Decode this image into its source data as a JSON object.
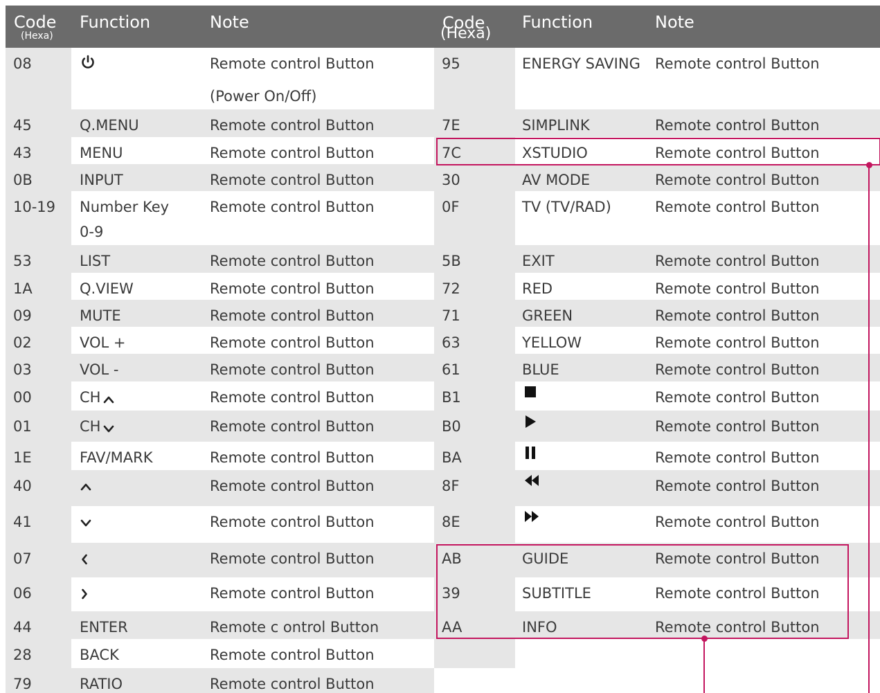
{
  "headers": {
    "left": {
      "code": "Code",
      "code_sub": "(Hexa)",
      "function": "Function",
      "note": "Note"
    },
    "right": {
      "code": "Code",
      "code_sub": "(Hexa)",
      "function": "Function",
      "note": "Note"
    }
  },
  "left_rows": [
    {
      "code": "08",
      "function": "",
      "icon": "power-icon",
      "note": "Remote control Button",
      "note2": "(Power On/Off)"
    },
    {
      "code": "45",
      "function": "Q.MENU",
      "note": "Remote control Button"
    },
    {
      "code": "43",
      "function": "MENU",
      "note": "Remote control Button"
    },
    {
      "code": "0B",
      "function": "INPUT",
      "note": "Remote control Button"
    },
    {
      "code": "10-19",
      "function": "Number Key",
      "function2": "0-9",
      "note": "Remote control Button"
    },
    {
      "code": "53",
      "function": "LIST",
      "note": "Remote control Button"
    },
    {
      "code": "1A",
      "function": "Q.VIEW",
      "note": "Remote control Button"
    },
    {
      "code": "09",
      "function": "MUTE",
      "note": "Remote control Button"
    },
    {
      "code": "02",
      "function": "VOL +",
      "note": "Remote control Button"
    },
    {
      "code": "03",
      "function": "VOL -",
      "note": "Remote control Button"
    },
    {
      "code": "00",
      "function": "CH",
      "icon": "chevron-up-icon",
      "note": "Remote control Button"
    },
    {
      "code": "01",
      "function": "CH",
      "icon": "chevron-down-icon",
      "note": "Remote control Button"
    },
    {
      "code": "1E",
      "function": "FAV/MARK",
      "note": "Remote control Button"
    },
    {
      "code": "40",
      "function": "",
      "icon": "chevron-up-icon",
      "note": "Remote control Button"
    },
    {
      "code": "41",
      "function": "",
      "icon": "chevron-down-icon",
      "note": "Remote control Button"
    },
    {
      "code": "07",
      "function": "",
      "icon": "chevron-left-icon",
      "note": "Remote control Button"
    },
    {
      "code": "06",
      "function": "",
      "icon": "chevron-right-icon",
      "note": "Remote control Button"
    },
    {
      "code": "44",
      "function": "ENTER",
      "note": "Remote c ontrol Button"
    },
    {
      "code": "28",
      "function": "BACK",
      "note": "Remote control Button"
    },
    {
      "code": "79",
      "function": "RATIO",
      "note": "Remote control Button"
    }
  ],
  "right_rows": [
    {
      "code": "95",
      "function": "ENERGY SAVING",
      "note": "Remote control Button"
    },
    {
      "code": "7E",
      "function": "SIMPLINK",
      "note": "Remote control Button"
    },
    {
      "code": "7C",
      "function": "XSTUDIO",
      "note": "Remote control Button"
    },
    {
      "code": "30",
      "function": "AV MODE",
      "note": "Remote control Button"
    },
    {
      "code": "0F",
      "function": "TV (TV/RAD)",
      "note": "Remote control Button"
    },
    {
      "code": "5B",
      "function": "EXIT",
      "note": "Remote control Button"
    },
    {
      "code": "72",
      "function": "RED",
      "note": "Remote control Button"
    },
    {
      "code": "71",
      "function": "GREEN",
      "note": "Remote control Button"
    },
    {
      "code": "63",
      "function": "YELLOW",
      "note": "Remote control Button"
    },
    {
      "code": "61",
      "function": "BLUE",
      "note": "Remote control Button"
    },
    {
      "code": "B1",
      "function": "",
      "icon": "stop-icon",
      "note": "Remote control Button"
    },
    {
      "code": "B0",
      "function": "",
      "icon": "play-icon",
      "note": "Remote control Button"
    },
    {
      "code": "BA",
      "function": "",
      "icon": "pause-icon",
      "note": "Remote control Button"
    },
    {
      "code": "8F",
      "function": "",
      "icon": "rewind-icon",
      "note": "Remote control Button"
    },
    {
      "code": "8E",
      "function": "",
      "icon": "fast-forward-icon",
      "note": "Remote control Button"
    },
    {
      "code": "AB",
      "function": "GUIDE",
      "note": "Remote control Button"
    },
    {
      "code": "39",
      "function": "SUBTITLE",
      "note": "Remote control Button"
    },
    {
      "code": "AA",
      "function": "INFO",
      "note": "Remote control Button"
    },
    {
      "code": "",
      "function": "",
      "note": ""
    }
  ],
  "colors": {
    "header_bg": "#6b6b6b",
    "gray_cell": "#e6e6e6",
    "callout": "#c3155e",
    "text": "#3a3a3a"
  }
}
